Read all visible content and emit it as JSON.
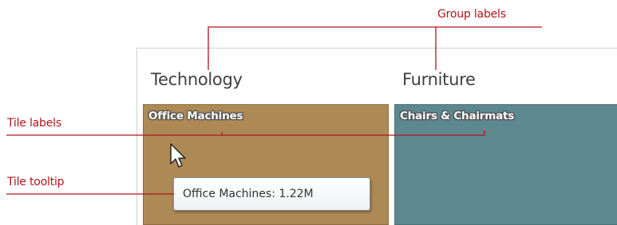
{
  "groups": [
    {
      "label": "Technology",
      "tile_label": "Office Machines",
      "tile_color": "#ad8a55"
    },
    {
      "label": "Furniture",
      "tile_label": "Chairs & Chairmats",
      "tile_color": "#5e8890"
    }
  ],
  "tooltip": {
    "text": "Office Machines: 1.22M"
  },
  "callouts": {
    "group_labels": "Group labels",
    "tile_labels": "Tile labels",
    "tile_tooltip": "Tile tooltip"
  },
  "callout_color": "#b0141c",
  "cursor_icon": "arrow-pointer-icon"
}
